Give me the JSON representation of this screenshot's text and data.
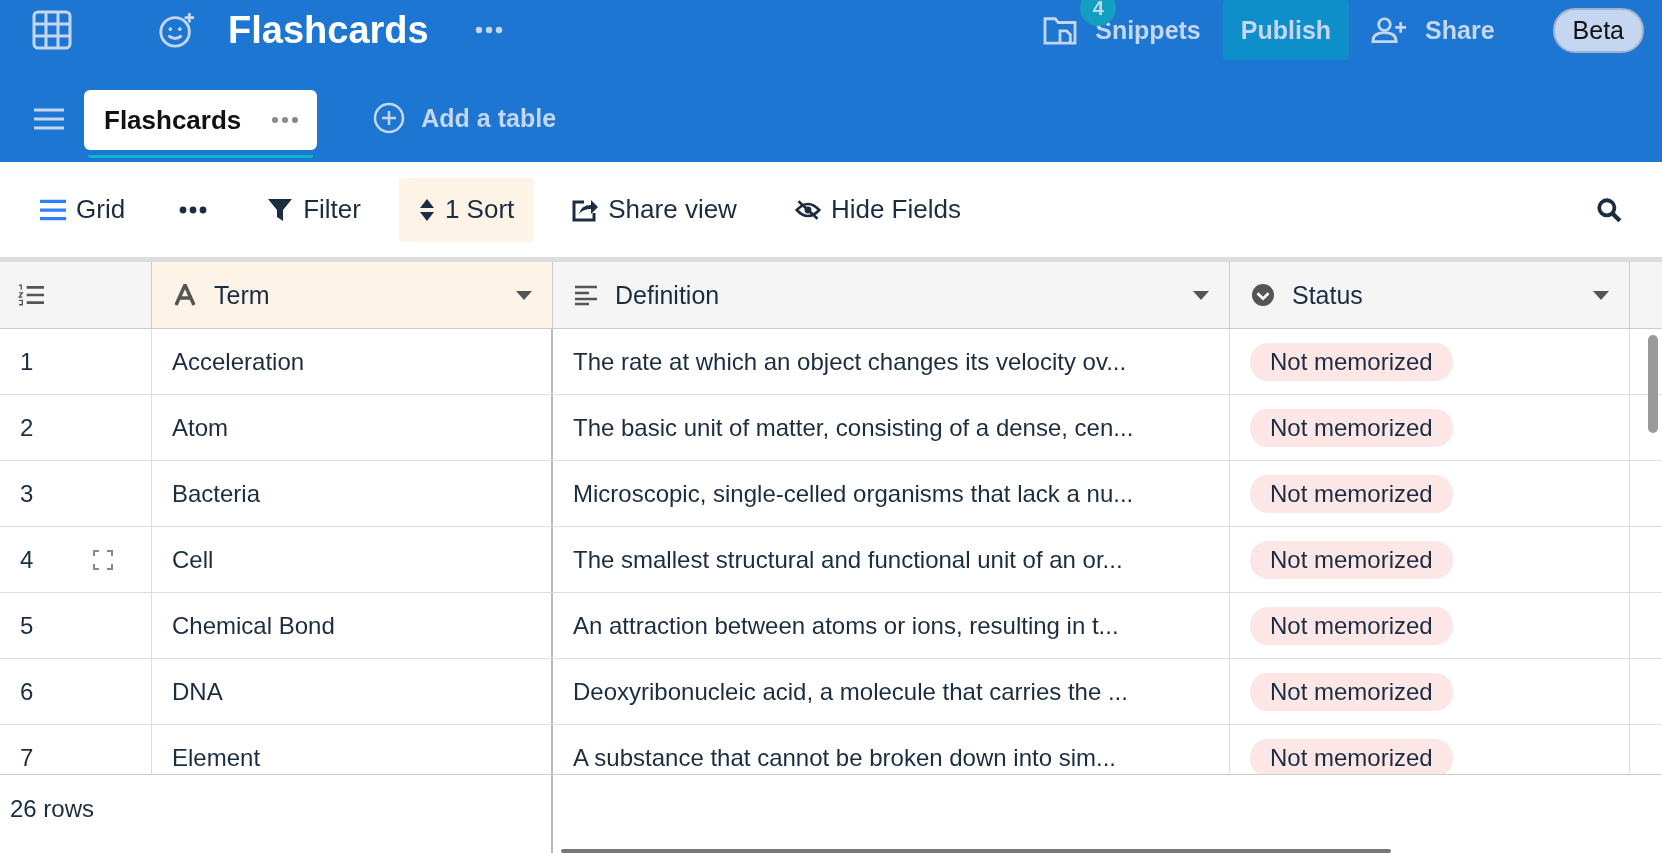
{
  "app_bar": {
    "base_title": "Flashcards",
    "snippets": {
      "label": "Snippets",
      "count": "4"
    },
    "publish": "Publish",
    "share": "Share",
    "beta": "Beta"
  },
  "tabs": [
    {
      "label": "Flashcards",
      "selected": true
    }
  ],
  "add_table": "Add a table",
  "toolbar": {
    "view": "Grid",
    "filter": "Filter",
    "sort": {
      "label": "1 Sort",
      "active": true
    },
    "share_view": "Share view",
    "hide_fields": "Hide Fields"
  },
  "table": {
    "columns": [
      {
        "label": "Term",
        "kind": "text",
        "sorted": true
      },
      {
        "label": "Definition",
        "kind": "long-text",
        "sorted": false
      },
      {
        "label": "Status",
        "kind": "select",
        "sorted": false
      }
    ],
    "rows": [
      {
        "number": "1",
        "term": "Acceleration",
        "definition": "The rate at which an object changes its velocity ov...",
        "status": "Not memorized",
        "hovered": false
      },
      {
        "number": "2",
        "term": "Atom",
        "definition": "The basic unit of matter, consisting of a dense, cen...",
        "status": "Not memorized",
        "hovered": false
      },
      {
        "number": "3",
        "term": "Bacteria",
        "definition": "Microscopic, single-celled organisms that lack a nu...",
        "status": "Not memorized",
        "hovered": false
      },
      {
        "number": "4",
        "term": "Cell",
        "definition": "The smallest structural and functional unit of an or...",
        "status": "Not memorized",
        "hovered": true
      },
      {
        "number": "5",
        "term": "Chemical Bond",
        "definition": "An attraction between atoms or ions, resulting in t...",
        "status": "Not memorized",
        "hovered": false
      },
      {
        "number": "6",
        "term": "DNA",
        "definition": "Deoxyribonucleic acid, a molecule that carries the ...",
        "status": "Not memorized",
        "hovered": false
      },
      {
        "number": "7",
        "term": "Element",
        "definition": "A substance that cannot be broken down into sim...",
        "status": "Not memorized",
        "hovered": false
      }
    ],
    "row_count": "26 rows"
  }
}
